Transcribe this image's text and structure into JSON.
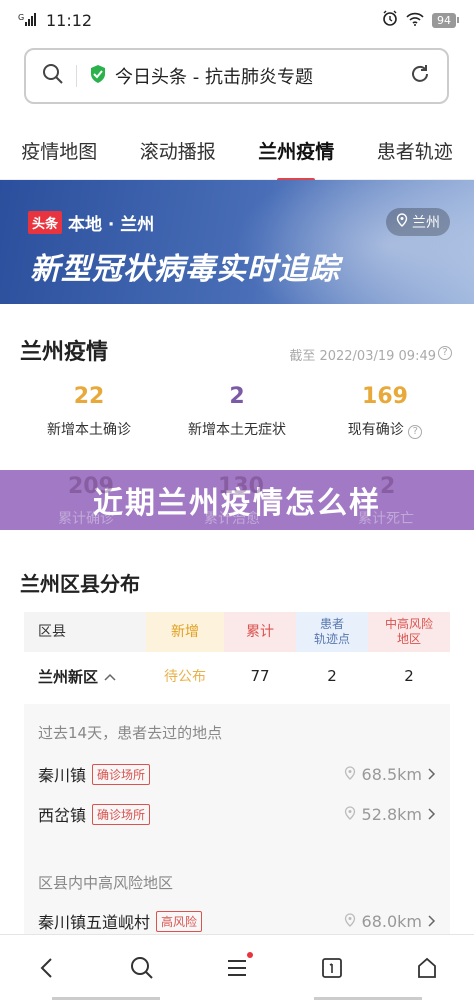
{
  "status": {
    "time": "11:12",
    "signal": "G",
    "battery": "94"
  },
  "search": {
    "text": "今日头条 - 抗击肺炎专题"
  },
  "tabs": [
    {
      "label": "疫情地图"
    },
    {
      "label": "滚动播报"
    },
    {
      "label": "兰州疫情"
    },
    {
      "label": "患者轨迹"
    }
  ],
  "banner": {
    "logo": "头条",
    "subtitle": "本地 · 兰州",
    "title": "新型冠状病毒实时追踪",
    "location": "兰州"
  },
  "summary": {
    "title": "兰州疫情",
    "updated": "截至 2022/03/19 09:49",
    "stats": [
      {
        "value": "22",
        "label": "新增本土确诊",
        "color": "#e8a93a"
      },
      {
        "value": "2",
        "label": "新增本土无症状",
        "color": "#7b5aa6"
      },
      {
        "value": "169",
        "label": "现有确诊",
        "color": "#e8a93a"
      }
    ],
    "ghost": [
      {
        "value": "209",
        "label": "累计确诊"
      },
      {
        "value": "130",
        "label": "累计治愈"
      },
      {
        "value": "2",
        "label": "累计死亡"
      }
    ]
  },
  "overlay": {
    "text": "近期兰州疫情怎么样"
  },
  "district": {
    "title": "兰州区县分布",
    "headers": {
      "district": "区县",
      "new": "新增",
      "total": "累计",
      "track": "患者\n轨迹点",
      "risk": "中高风险\n地区"
    },
    "row": {
      "name": "兰州新区",
      "new": "待公布",
      "total": "77",
      "track": "2",
      "risk": "2"
    },
    "section1": "过去14天，患者去过的地点",
    "places1": [
      {
        "name": "秦川镇",
        "tag": "确诊场所",
        "distance": "68.5km"
      },
      {
        "name": "西岔镇",
        "tag": "确诊场所",
        "distance": "52.8km"
      }
    ],
    "section2": "区县内中高风险地区",
    "places2": [
      {
        "name": "秦川镇五道岘村",
        "tag": "高风险",
        "distance": "68.0km"
      }
    ]
  },
  "colors": {
    "accent": "#e0454d",
    "overlay": "#a179c4",
    "banner": "#2b4f9c"
  }
}
